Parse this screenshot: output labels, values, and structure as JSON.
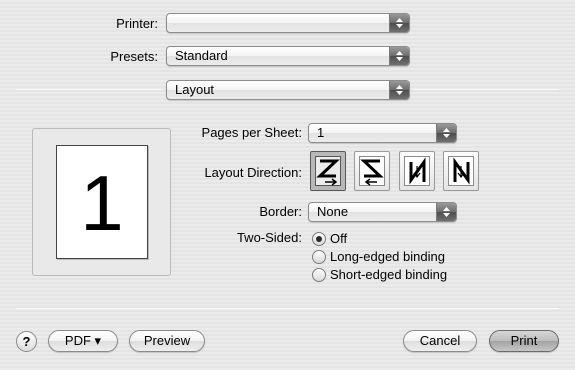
{
  "printer": {
    "label": "Printer:",
    "value": ""
  },
  "presets": {
    "label": "Presets:",
    "value": "Standard"
  },
  "section": {
    "value": "Layout"
  },
  "preview": {
    "page_number": "1"
  },
  "layout": {
    "pages_per_sheet_label": "Pages per Sheet:",
    "pages_per_sheet_value": "1",
    "direction_label": "Layout Direction:",
    "directions": [
      {
        "name": "z-order",
        "selected": true
      },
      {
        "name": "reverse-z-order",
        "selected": false
      },
      {
        "name": "n-order-reverse",
        "selected": false
      },
      {
        "name": "n-order",
        "selected": false
      }
    ],
    "border_label": "Border:",
    "border_value": "None",
    "two_sided_label": "Two-Sided:",
    "two_sided_options": [
      {
        "label": "Off",
        "selected": true
      },
      {
        "label": "Long-edged binding",
        "selected": false
      },
      {
        "label": "Short-edged binding",
        "selected": false
      }
    ]
  },
  "footer": {
    "help_label": "?",
    "pdf_label": "PDF ▾",
    "preview_label": "Preview",
    "cancel_label": "Cancel",
    "print_label": "Print"
  }
}
